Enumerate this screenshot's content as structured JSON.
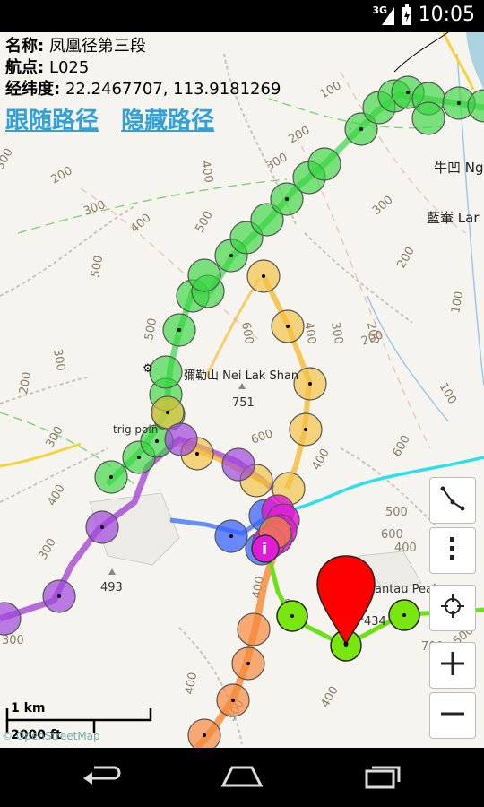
{
  "status": {
    "network": "3G",
    "time": "10:05"
  },
  "info": {
    "name_label": "名称:",
    "name_value": "凤凰径第三段",
    "waypoint_label": "航点:",
    "waypoint_value": "L025",
    "coords_label": "经纬度:",
    "coords_value": "22.2467707, 113.9181269"
  },
  "actions": {
    "follow": "跟随路径",
    "hide": "隐藏路径"
  },
  "map_labels": {
    "place1": "牛凹 Ng",
    "place2": "藍輋 Lar",
    "peak1": "彌勒山 Nei Lak Shan",
    "peak1_height": "751",
    "trig": "trig poin",
    "height_493": "493",
    "height_434": "434",
    "peak2": "antau Peak",
    "i_marker": "i"
  },
  "contours": [
    "100",
    "200",
    "300",
    "400",
    "500",
    "600",
    "700"
  ],
  "scale": {
    "km": "1 km",
    "ft": "2000 ft"
  },
  "copyright": "© OpenStreetMap",
  "controls": [
    "route-toggle",
    "more-options",
    "locate",
    "zoom-in",
    "zoom-out"
  ]
}
